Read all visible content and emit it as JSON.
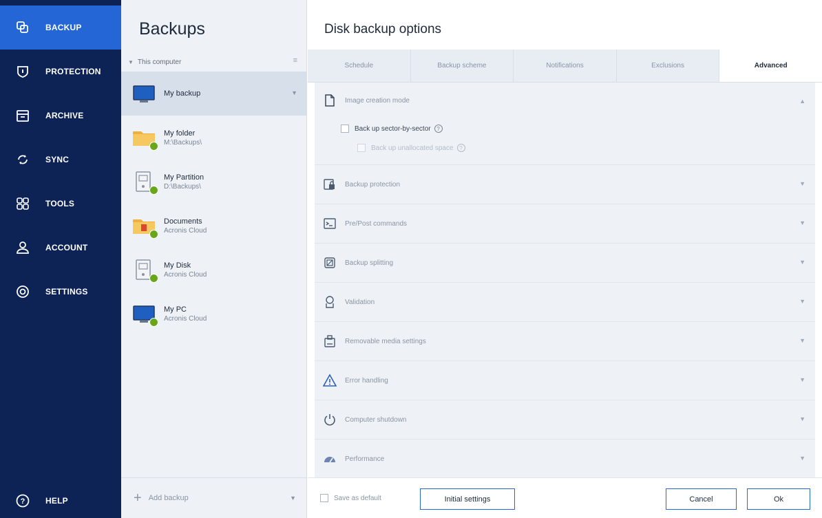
{
  "nav": {
    "items": [
      {
        "label": "BACKUP",
        "icon": "backup-icon"
      },
      {
        "label": "PROTECTION",
        "icon": "shield-icon"
      },
      {
        "label": "ARCHIVE",
        "icon": "archive-icon"
      },
      {
        "label": "SYNC",
        "icon": "sync-icon"
      },
      {
        "label": "TOOLS",
        "icon": "tools-grid-icon"
      },
      {
        "label": "ACCOUNT",
        "icon": "account-icon"
      },
      {
        "label": "SETTINGS",
        "icon": "settings-icon"
      }
    ],
    "help": {
      "label": "HELP",
      "icon": "help-icon"
    },
    "accent": "#2466d6",
    "background": "#0d2255"
  },
  "list": {
    "title": "Backups",
    "group": "This computer",
    "items": [
      {
        "name": "My backup",
        "sub": "",
        "icon": "monitor-icon"
      },
      {
        "name": "My folder",
        "sub": "M:\\Backups\\",
        "icon": "folder-icon"
      },
      {
        "name": "My Partition",
        "sub": "D:\\Backups\\",
        "icon": "partition-icon"
      },
      {
        "name": "Documents",
        "sub": "Acronis Cloud",
        "icon": "documents-icon"
      },
      {
        "name": "My Disk",
        "sub": "Acronis Cloud",
        "icon": "disk-icon"
      },
      {
        "name": "My PC",
        "sub": "Acronis Cloud",
        "icon": "monitor-icon"
      }
    ],
    "add_label": "Add backup"
  },
  "panel": {
    "title": "Disk backup options",
    "tabs": [
      "Schedule",
      "Backup scheme",
      "Notifications",
      "Exclusions",
      "Advanced"
    ],
    "active_tab": "Advanced",
    "expanded": {
      "label": "Image creation mode",
      "options": [
        {
          "label": "Back up sector-by-sector",
          "checked": false,
          "enabled": true
        },
        {
          "label": "Back up unallocated space",
          "checked": false,
          "enabled": false
        }
      ]
    },
    "sections": [
      {
        "label": "Backup protection",
        "icon": "lock-icon"
      },
      {
        "label": "Pre/Post commands",
        "icon": "terminal-icon"
      },
      {
        "label": "Backup splitting",
        "icon": "split-icon"
      },
      {
        "label": "Validation",
        "icon": "validation-icon"
      },
      {
        "label": "Removable media settings",
        "icon": "removable-media-icon"
      },
      {
        "label": "Error handling",
        "icon": "warning-icon"
      },
      {
        "label": "Computer shutdown",
        "icon": "power-icon"
      },
      {
        "label": "Performance",
        "icon": "gauge-icon"
      }
    ],
    "footer": {
      "save_default": "Save as default",
      "initial_settings": "Initial settings",
      "cancel": "Cancel",
      "ok": "Ok"
    }
  },
  "colors": {
    "status_ok": "#6aa61c"
  }
}
